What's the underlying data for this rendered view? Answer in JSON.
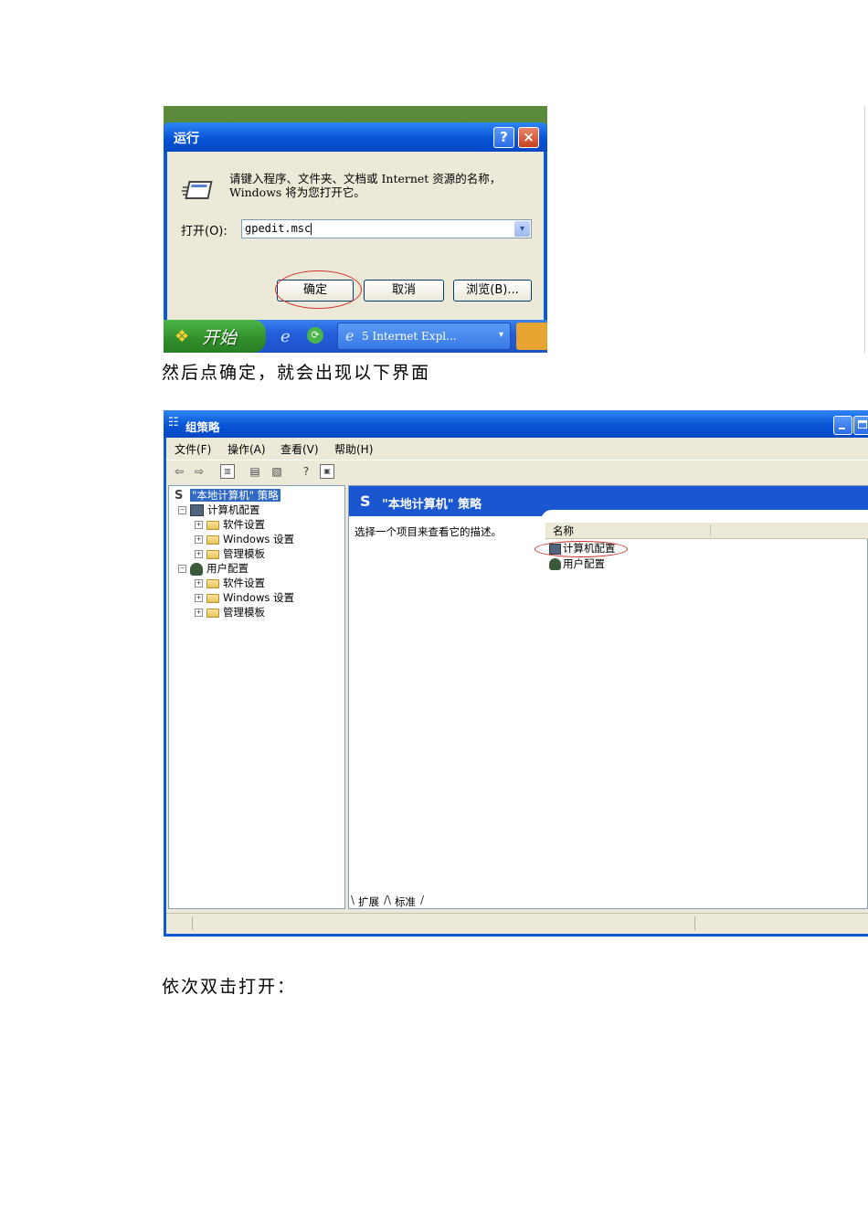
{
  "run_dialog": {
    "title": "运行",
    "help_label": "?",
    "close_label": "×",
    "description": "请键入程序、文件夹、文档或 Internet 资源的名称，Windows 将为您打开它。",
    "open_label": "打开(O):",
    "input_value": "gpedit.msc",
    "dropdown_glyph": "▾",
    "ok_label": "确定",
    "cancel_label": "取消",
    "browse_label": "浏览(B)...",
    "highlight_color": "#d0342c"
  },
  "taskbar": {
    "start_label": "开始",
    "task_ie_label": "5 Internet Expl...",
    "ie_icon": "e-icon",
    "task_arrow": "▾"
  },
  "caption1": "然后点确定，就会出现以下界面",
  "group_policy": {
    "title": "组策略",
    "menus": [
      "文件(F)",
      "操作(A)",
      "查看(V)",
      "帮助(H)"
    ],
    "tree": {
      "root": "\"本地计算机\" 策略",
      "computer_config": "计算机配置",
      "computer_children": [
        "软件设置",
        "Windows 设置",
        "管理模板"
      ],
      "user_config": "用户配置",
      "user_children": [
        "软件设置",
        "Windows 设置",
        "管理模板"
      ]
    },
    "right_header": "\"本地计算机\" 策略",
    "description": "选择一个项目来查看它的描述。",
    "column_name": "名称",
    "list_items": [
      "计算机配置",
      "用户配置"
    ],
    "tabs": [
      "扩展",
      "标准"
    ]
  },
  "caption2": "依次双击打开："
}
